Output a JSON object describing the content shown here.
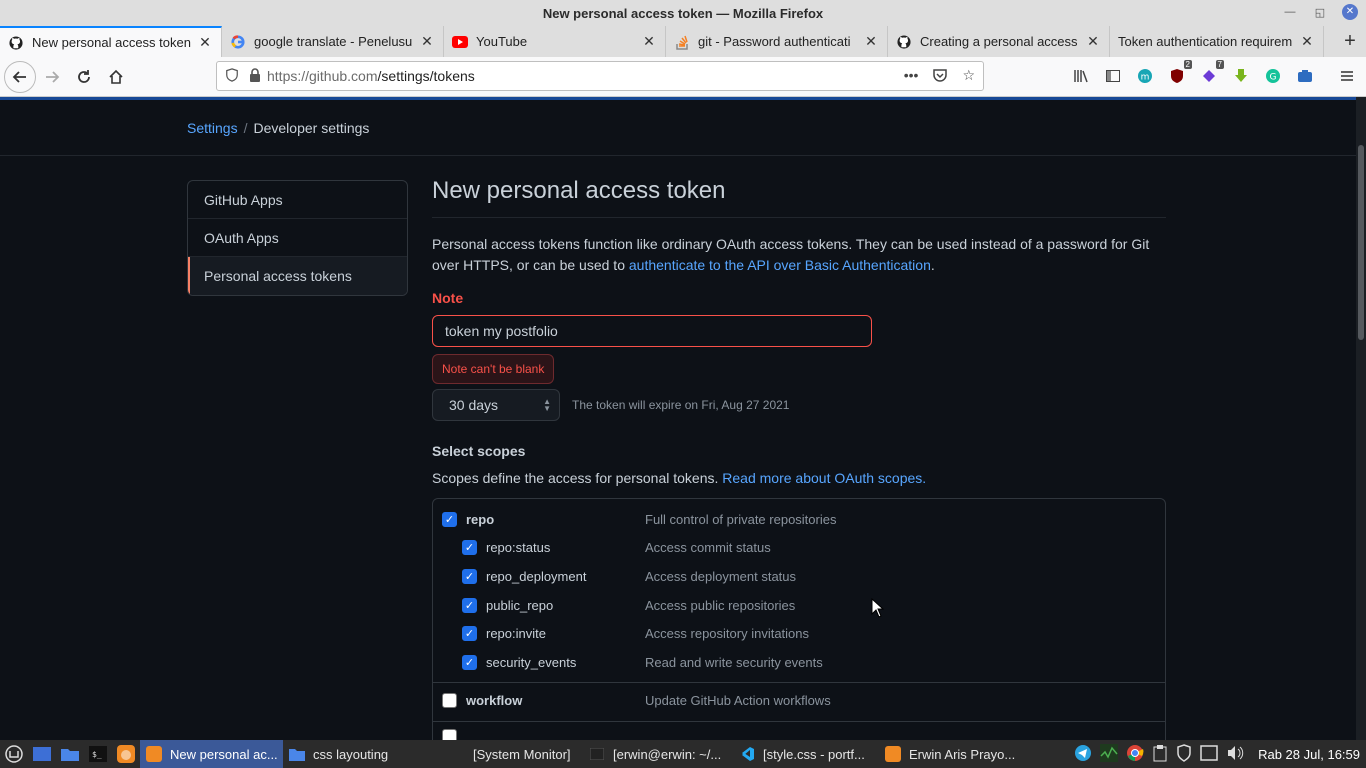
{
  "window": {
    "title": "New personal access token — Mozilla Firefox"
  },
  "tabs": [
    {
      "label": "New personal access token",
      "icon": "github-icon",
      "active": true
    },
    {
      "label": "google translate - Penelusu",
      "icon": "google-icon",
      "active": false
    },
    {
      "label": "YouTube",
      "icon": "youtube-icon",
      "active": false
    },
    {
      "label": "git - Password authenticati",
      "icon": "stackoverflow-icon",
      "active": false
    },
    {
      "label": "Creating a personal access",
      "icon": "github-icon",
      "active": false
    },
    {
      "label": "Token authentication requirem",
      "icon": "none",
      "active": false
    }
  ],
  "navbar": {
    "url_host": "https://github.com",
    "url_path": "/settings/tokens"
  },
  "toolbar_badges": {
    "ublock": "2",
    "ext": "7"
  },
  "breadcrumb": {
    "settings": "Settings",
    "separator": "/",
    "developer": "Developer settings"
  },
  "sidenav": [
    {
      "label": "GitHub Apps",
      "selected": false
    },
    {
      "label": "OAuth Apps",
      "selected": false
    },
    {
      "label": "Personal access tokens",
      "selected": true
    }
  ],
  "main": {
    "title": "New personal access token",
    "intro_text": "Personal access tokens function like ordinary OAuth access tokens. They can be used instead of a password for Git over HTTPS, or can be used to ",
    "intro_link": "authenticate to the API over Basic Authentication",
    "intro_end": ".",
    "note_label": "Note",
    "note_value": "token my postfolio",
    "note_error": "Note can't be blank",
    "expiration_value": "30 days",
    "expiration_note": "The token will expire on Fri, Aug 27 2021",
    "scopes_title": "Select scopes",
    "scopes_desc": "Scopes define the access for personal tokens. ",
    "scopes_link": "Read more about OAuth scopes."
  },
  "scopes": [
    {
      "name": "repo",
      "desc": "Full control of private repositories",
      "checked": true,
      "children": [
        {
          "name": "repo:status",
          "desc": "Access commit status",
          "checked": true
        },
        {
          "name": "repo_deployment",
          "desc": "Access deployment status",
          "checked": true
        },
        {
          "name": "public_repo",
          "desc": "Access public repositories",
          "checked": true
        },
        {
          "name": "repo:invite",
          "desc": "Access repository invitations",
          "checked": true
        },
        {
          "name": "security_events",
          "desc": "Read and write security events",
          "checked": true
        }
      ]
    },
    {
      "name": "workflow",
      "desc": "Update GitHub Action workflows",
      "checked": false,
      "children": []
    }
  ],
  "taskbar": {
    "tasks": [
      {
        "label": "New personal ac...",
        "active": true
      },
      {
        "label": "css layouting",
        "active": false
      },
      {
        "label": "[System Monitor]",
        "active": false
      },
      {
        "label": "[erwin@erwin: ~/...",
        "active": false
      },
      {
        "label": "[style.css - portf...",
        "active": false
      },
      {
        "label": "Erwin Aris Prayo...",
        "active": false
      }
    ],
    "clock": "Rab 28 Jul, 16:59"
  },
  "colors": {
    "page_bg": "#0d1117",
    "link": "#58a6ff",
    "error": "#f85149",
    "checkbox": "#1f6feb",
    "nav_selected_accent": "#f78166"
  }
}
